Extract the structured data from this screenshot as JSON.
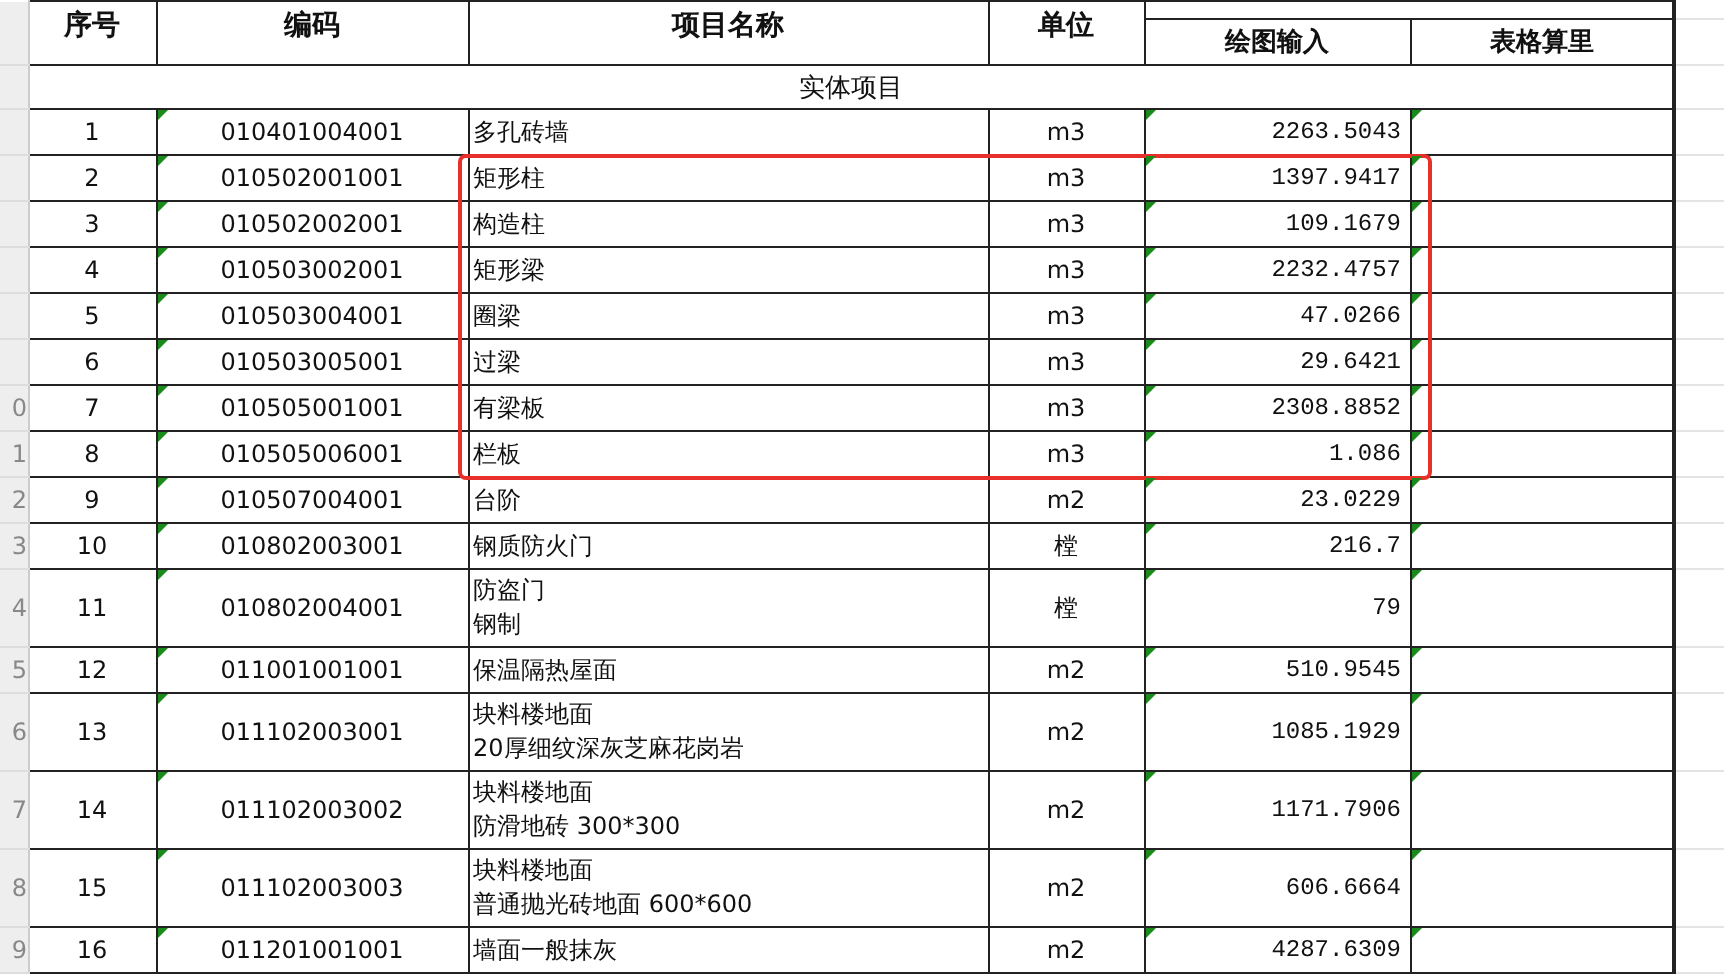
{
  "columns": {
    "seq": "序号",
    "code": "编码",
    "name": "项目名称",
    "unit": "单位",
    "subcolumns": [
      "绘图输入",
      "表格算里"
    ]
  },
  "section": "实体项目",
  "rows": [
    {
      "seq": "1",
      "code": "010401004001",
      "name": [
        "多孔砖墙"
      ],
      "unit": "m3",
      "drawing_input": "2263.5043",
      "highlighted": false
    },
    {
      "seq": "2",
      "code": "010502001001",
      "name": [
        "矩形柱"
      ],
      "unit": "m3",
      "drawing_input": "1397.9417",
      "highlighted": true
    },
    {
      "seq": "3",
      "code": "010502002001",
      "name": [
        "构造柱"
      ],
      "unit": "m3",
      "drawing_input": "109.1679",
      "highlighted": true
    },
    {
      "seq": "4",
      "code": "010503002001",
      "name": [
        "矩形梁"
      ],
      "unit": "m3",
      "drawing_input": "2232.4757",
      "highlighted": true
    },
    {
      "seq": "5",
      "code": "010503004001",
      "name": [
        "圈梁"
      ],
      "unit": "m3",
      "drawing_input": "47.0266",
      "highlighted": true
    },
    {
      "seq": "6",
      "code": "010503005001",
      "name": [
        "过梁"
      ],
      "unit": "m3",
      "drawing_input": "29.6421",
      "highlighted": true
    },
    {
      "seq": "7",
      "code": "010505001001",
      "name": [
        "有梁板"
      ],
      "unit": "m3",
      "drawing_input": "2308.8852",
      "highlighted": true,
      "row_number": "0"
    },
    {
      "seq": "8",
      "code": "010505006001",
      "name": [
        "栏板"
      ],
      "unit": "m3",
      "drawing_input": "1.086",
      "highlighted": true,
      "row_number": "1"
    },
    {
      "seq": "9",
      "code": "010507004001",
      "name": [
        "台阶"
      ],
      "unit": "m2",
      "drawing_input": "23.0229",
      "highlighted": false,
      "row_number": "2"
    },
    {
      "seq": "10",
      "code": "010802003001",
      "name": [
        "钢质防火门"
      ],
      "unit": "樘",
      "drawing_input": "216.7",
      "highlighted": false,
      "row_number": "3"
    },
    {
      "seq": "11",
      "code": "010802004001",
      "name": [
        "防盗门",
        "钢制"
      ],
      "unit": "樘",
      "drawing_input": "79",
      "highlighted": false,
      "row_number": "4"
    },
    {
      "seq": "12",
      "code": "011001001001",
      "name": [
        "保温隔热屋面"
      ],
      "unit": "m2",
      "drawing_input": "510.9545",
      "highlighted": false,
      "row_number": "5"
    },
    {
      "seq": "13",
      "code": "011102003001",
      "name": [
        "块料楼地面",
        "20厚细纹深灰芝麻花岗岩"
      ],
      "unit": "m2",
      "drawing_input": "1085.1929",
      "highlighted": false,
      "row_number": "6"
    },
    {
      "seq": "14",
      "code": "011102003002",
      "name": [
        "块料楼地面",
        "防滑地砖 300*300"
      ],
      "unit": "m2",
      "drawing_input": "1171.7906",
      "highlighted": false,
      "row_number": "7"
    },
    {
      "seq": "15",
      "code": "011102003003",
      "name": [
        "块料楼地面",
        "普通抛光砖地面 600*600"
      ],
      "unit": "m2",
      "drawing_input": "606.6664",
      "highlighted": false,
      "row_number": "8"
    },
    {
      "seq": "16",
      "code": "011201001001",
      "name": [
        "墙面一般抹灰"
      ],
      "unit": "m2",
      "drawing_input": "4287.6309",
      "highlighted": false,
      "row_number": "9"
    }
  ]
}
